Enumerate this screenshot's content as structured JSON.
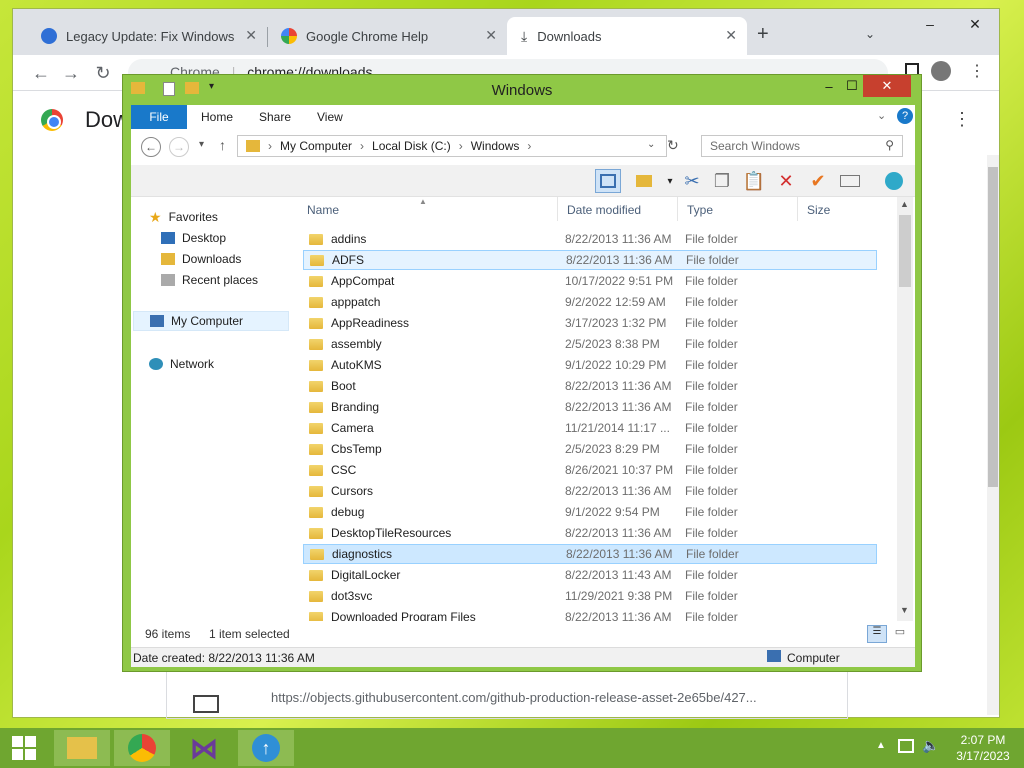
{
  "chrome": {
    "tabs": [
      {
        "title": "Legacy Update: Fix Windows Upd",
        "icon": "legacy-update-icon"
      },
      {
        "title": "Google Chrome Help",
        "icon": "google-icon"
      },
      {
        "title": "Downloads",
        "icon": "download-icon"
      }
    ],
    "omnibox_brand": "Chrome",
    "omnibox_url": "chrome://downloads",
    "page_title": "Dow",
    "download_url": "https://objects.githubusercontent.com/github-production-release-asset-2e65be/427..."
  },
  "explorer": {
    "title": "Windows",
    "ribbon_tabs": [
      "File",
      "Home",
      "Share",
      "View"
    ],
    "breadcrumb": [
      "My Computer",
      "Local Disk (C:)",
      "Windows"
    ],
    "search_placeholder": "Search Windows",
    "nav": {
      "favorites": "Favorites",
      "favorite_items": [
        "Desktop",
        "Downloads",
        "Recent places"
      ],
      "computer": "My Computer",
      "network": "Network"
    },
    "columns": [
      "Name",
      "Date modified",
      "Type",
      "Size"
    ],
    "files": [
      {
        "name": "addins",
        "date": "8/22/2013 11:36 AM",
        "type": "File folder"
      },
      {
        "name": "ADFS",
        "date": "8/22/2013 11:36 AM",
        "type": "File folder"
      },
      {
        "name": "AppCompat",
        "date": "10/17/2022 9:51 PM",
        "type": "File folder"
      },
      {
        "name": "apppatch",
        "date": "9/2/2022 12:59 AM",
        "type": "File folder"
      },
      {
        "name": "AppReadiness",
        "date": "3/17/2023 1:32 PM",
        "type": "File folder"
      },
      {
        "name": "assembly",
        "date": "2/5/2023 8:38 PM",
        "type": "File folder"
      },
      {
        "name": "AutoKMS",
        "date": "9/1/2022 10:29 PM",
        "type": "File folder"
      },
      {
        "name": "Boot",
        "date": "8/22/2013 11:36 AM",
        "type": "File folder"
      },
      {
        "name": "Branding",
        "date": "8/22/2013 11:36 AM",
        "type": "File folder"
      },
      {
        "name": "Camera",
        "date": "11/21/2014 11:17 ...",
        "type": "File folder"
      },
      {
        "name": "CbsTemp",
        "date": "2/5/2023 8:29 PM",
        "type": "File folder"
      },
      {
        "name": "CSC",
        "date": "8/26/2021 10:37 PM",
        "type": "File folder"
      },
      {
        "name": "Cursors",
        "date": "8/22/2013 11:36 AM",
        "type": "File folder"
      },
      {
        "name": "debug",
        "date": "9/1/2022 9:54 PM",
        "type": "File folder"
      },
      {
        "name": "DesktopTileResources",
        "date": "8/22/2013 11:36 AM",
        "type": "File folder"
      },
      {
        "name": "diagnostics",
        "date": "8/22/2013 11:36 AM",
        "type": "File folder"
      },
      {
        "name": "DigitalLocker",
        "date": "8/22/2013 11:43 AM",
        "type": "File folder"
      },
      {
        "name": "dot3svc",
        "date": "11/29/2021 9:38 PM",
        "type": "File folder"
      },
      {
        "name": "Downloaded Program Files",
        "date": "8/22/2013 11:36 AM",
        "type": "File folder"
      }
    ],
    "status_items": "96 items",
    "status_selected": "1 item selected",
    "details": "Date created: 8/22/2013 11:36 AM",
    "details_location": "Computer"
  },
  "taskbar": {
    "time": "2:07 PM",
    "date": "3/17/2023"
  },
  "colors": {
    "accent": "#1979ca",
    "window_frame": "#8fc846",
    "taskbar": "#6fa630"
  }
}
